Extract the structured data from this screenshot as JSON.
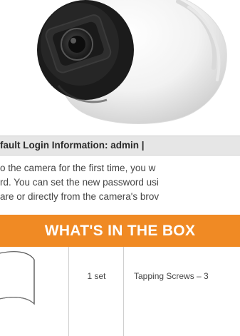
{
  "login": {
    "label": "fault Login Information: admin |"
  },
  "description": {
    "lines": [
      "o the camera for the first time, you w",
      "rd. You can set the new password usi",
      "are or directly from the camera's brov"
    ]
  },
  "box": {
    "title": "WHAT'S IN THE BOX",
    "rows": [
      {
        "qty": "1 set",
        "item": "Tapping Screws – 3"
      }
    ]
  },
  "colors": {
    "accent": "#f08a24",
    "login_bar": "#e6e6e6"
  }
}
